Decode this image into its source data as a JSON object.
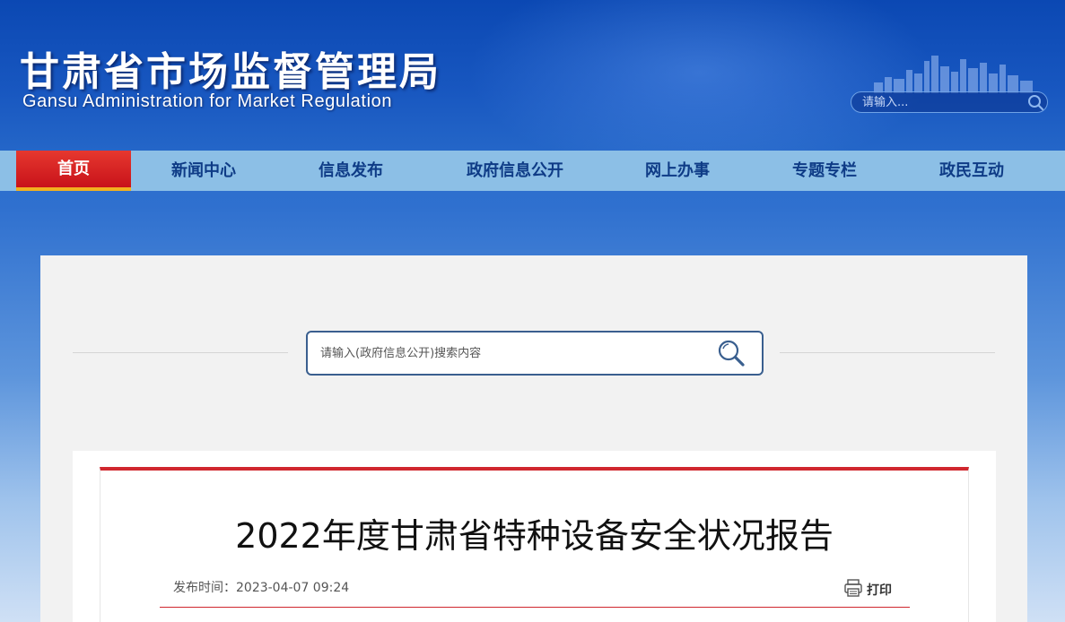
{
  "header": {
    "title": "甘肃省市场监督管理局",
    "subtitle": "Gansu Administration for Market Regulation",
    "search_placeholder": "请输入..."
  },
  "nav": {
    "items": [
      {
        "label": "首页",
        "active": true
      },
      {
        "label": "新闻中心"
      },
      {
        "label": "信息发布"
      },
      {
        "label": "政府信息公开"
      },
      {
        "label": "网上办事"
      },
      {
        "label": "专题专栏"
      },
      {
        "label": "政民互动"
      }
    ]
  },
  "gov_search": {
    "placeholder": "请输入(政府信息公开)搜索内容"
  },
  "article": {
    "title": "2022年度甘肃省特种设备安全状况报告",
    "publish_label": "发布时间：",
    "publish_time": "2023-04-07 09:24",
    "print_label": "打印"
  },
  "colors": {
    "header_blue": "#1857c0",
    "nav_bg": "#8cbfe6",
    "nav_active": "#d0272e",
    "accent_red": "#d0272e"
  }
}
